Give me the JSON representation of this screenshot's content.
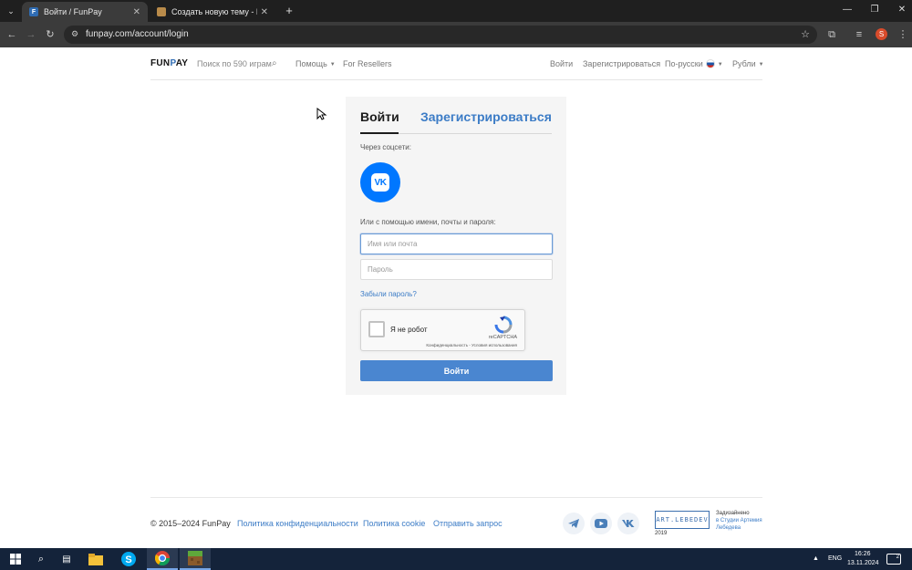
{
  "browser": {
    "tabs": [
      {
        "title": "Войти / FunPay",
        "favicon": "F",
        "active": true
      },
      {
        "title": "Создать новую тему - ReallyM",
        "favicon": "",
        "active": false
      }
    ],
    "url": "funpay.com/account/login"
  },
  "header": {
    "logo_left": "FUN",
    "logo_mark": "P",
    "logo_right": "AY",
    "search_placeholder": "Поиск по 590 играм",
    "help": "Помощь",
    "resellers": "For Resellers",
    "login": "Войти",
    "register": "Зарегистрироваться",
    "language": "По-русски",
    "currency": "Рубли"
  },
  "card": {
    "tab_login": "Войти",
    "tab_register": "Зарегистрироваться",
    "social_label": "Через соцсети:",
    "or_label": "Или с помощью имени, почты и пароля:",
    "username_placeholder": "Имя или почта",
    "password_placeholder": "Пароль",
    "forgot_password": "Забыли пароль?",
    "captcha_label": "Я не робот",
    "captcha_brand": "reCAPTCHA",
    "captcha_links": "Конфиденциальность - Условия использования",
    "submit": "Войти",
    "vk_mark": "VK"
  },
  "footer": {
    "copyright": "© 2015–2024 FunPay",
    "privacy": "Политика конфиденциальности",
    "cookie": "Политика cookie",
    "request": "Отправить запрос",
    "artl_logo": "ART.LEBEDEV",
    "artl_year": "2019",
    "designed_1": "Задизайнено",
    "designed_2": "в Студии Артемия",
    "designed_3": "Лебедева"
  },
  "taskbar": {
    "lang": "ENG",
    "time": "16:26",
    "date": "13.11.2024",
    "notifications": "2"
  },
  "colors": {
    "accent": "#3c7cc6",
    "button": "#4a86d0",
    "vk": "#0077ff"
  }
}
